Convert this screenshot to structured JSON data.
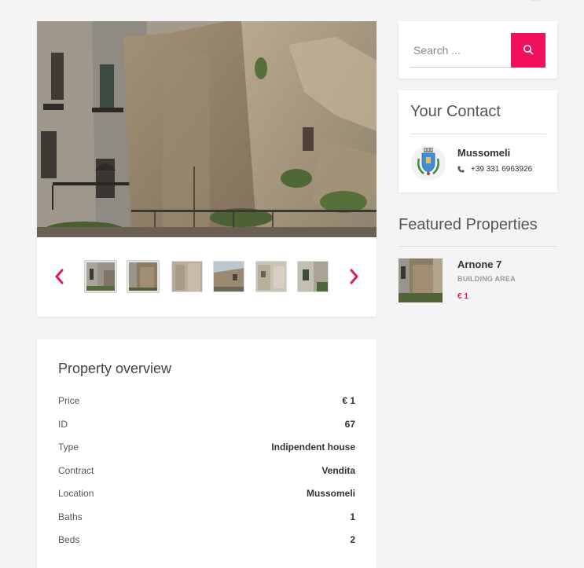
{
  "gallery": {
    "prev_icon": "chevron-left-icon",
    "next_icon": "chevron-right-icon",
    "thumbnails": [
      {
        "name": "thumb-1",
        "active": true
      },
      {
        "name": "thumb-2",
        "active": true
      },
      {
        "name": "thumb-3",
        "active": false
      },
      {
        "name": "thumb-4",
        "active": false
      },
      {
        "name": "thumb-5",
        "active": false
      },
      {
        "name": "thumb-6",
        "active": false
      }
    ]
  },
  "overview": {
    "title": "Property overview",
    "rows": [
      {
        "label": "Price",
        "value": "€ 1"
      },
      {
        "label": "ID",
        "value": "67"
      },
      {
        "label": "Type",
        "value": "Indipendent house"
      },
      {
        "label": "Contract",
        "value": "Vendita"
      },
      {
        "label": "Location",
        "value": "Mussomeli"
      },
      {
        "label": "Baths",
        "value": "1"
      },
      {
        "label": "Beds",
        "value": "2"
      }
    ]
  },
  "search": {
    "placeholder": "Search ...",
    "button_icon": "search-icon"
  },
  "contact": {
    "title": "Your Contact",
    "name": "Mussomeli",
    "phone": "+39 331 6963926",
    "phone_icon": "phone-icon"
  },
  "featured": {
    "title": "Featured Properties",
    "items": [
      {
        "name": "Arnone 7",
        "category": "BUILDING AREA",
        "price": "€ 1"
      }
    ]
  },
  "colors": {
    "accent": "#f2115f",
    "background": "#f4f4f4"
  }
}
